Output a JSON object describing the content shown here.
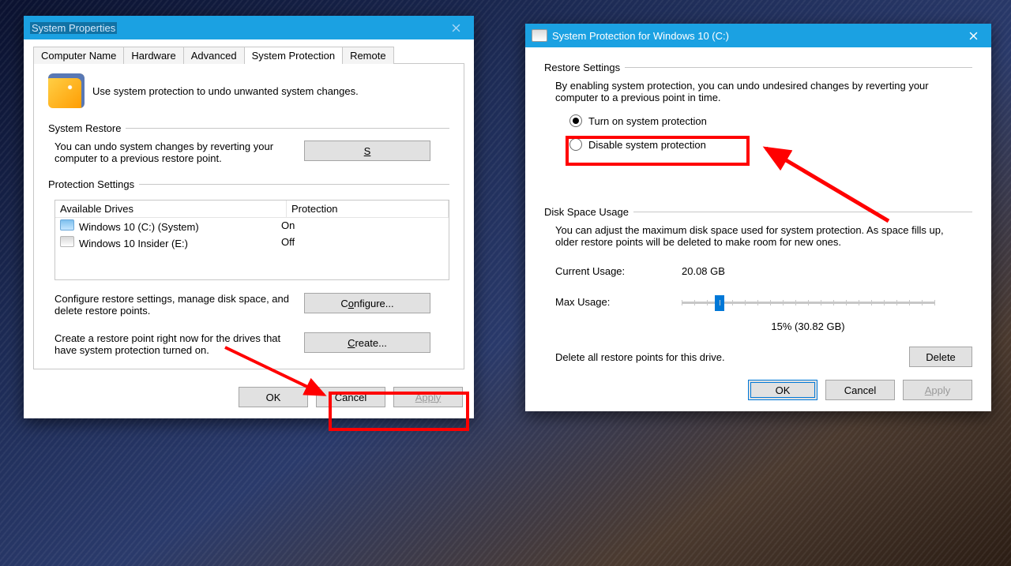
{
  "dlg1": {
    "title": "System Properties",
    "tabs": [
      "Computer Name",
      "Hardware",
      "Advanced",
      "System Protection",
      "Remote"
    ],
    "activeTab": 3,
    "heroText": "Use system protection to undo unwanted system changes.",
    "restore": {
      "legend": "System Restore",
      "text": "You can undo system changes by reverting your computer to a previous restore point.",
      "button": "System Restore..."
    },
    "settings": {
      "legend": "Protection Settings",
      "cols": [
        "Available Drives",
        "Protection"
      ],
      "drives": [
        {
          "name": "Windows 10 (C:) (System)",
          "protection": "On",
          "icon": "hd"
        },
        {
          "name": "Windows 10 Insider (E:)",
          "protection": "Off",
          "icon": "usb"
        }
      ],
      "configureText": "Configure restore settings, manage disk space, and delete restore points.",
      "configureBtn": "Configure...",
      "createText": "Create a restore point right now for the drives that have system protection turned on.",
      "createBtn": "Create..."
    },
    "buttons": {
      "ok": "OK",
      "cancel": "Cancel",
      "apply": "Apply"
    }
  },
  "dlg2": {
    "title": "System Protection for Windows 10 (C:)",
    "restore": {
      "legend": "Restore Settings",
      "intro": "By enabling system protection, you can undo undesired changes by reverting your computer to a previous point in time.",
      "opt_on": "Turn on system protection",
      "opt_off": "Disable system protection"
    },
    "disk": {
      "legend": "Disk Space Usage",
      "intro": "You can adjust the maximum disk space used for system protection. As space fills up, older restore points will be deleted to make room for new ones.",
      "currentLabel": "Current Usage:",
      "currentValue": "20.08 GB",
      "maxLabel": "Max Usage:",
      "sliderPercent": 15,
      "sliderText": "15% (30.82 GB)",
      "deleteText": "Delete all restore points for this drive.",
      "deleteBtn": "Delete"
    },
    "buttons": {
      "ok": "OK",
      "cancel": "Cancel",
      "apply": "Apply"
    }
  }
}
